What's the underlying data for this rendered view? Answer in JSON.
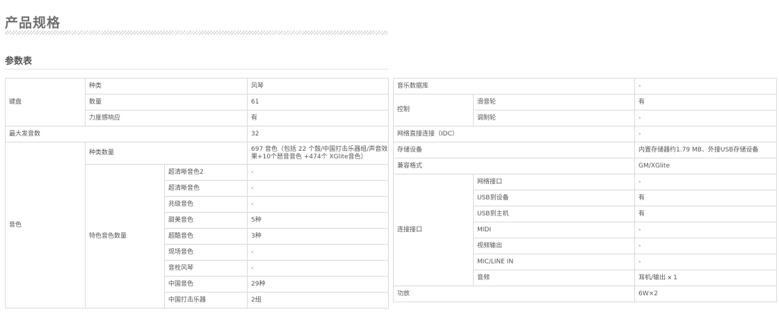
{
  "page_title": "产品规格",
  "section_title": "参数表",
  "left_table": {
    "keyboard": {
      "label": "键盘",
      "type_label": "种类",
      "type_value": "风琴",
      "count_label": "数量",
      "count_value": "61",
      "velocity_label": "力度感响应",
      "velocity_value": "有"
    },
    "polyphony": {
      "label": "最大发音数",
      "value": "32"
    },
    "voices": {
      "label": "音色",
      "count_label": "种类数量",
      "count_value": "697 音色（包括 22 个鼓/中国打击乐器组/声音效果+10个琶音音色 +474个 XGlite音色）",
      "special_label": "特色音色数量",
      "special": [
        {
          "label": "超清晰音色2",
          "value": "-"
        },
        {
          "label": "超清晰音色",
          "value": "-"
        },
        {
          "label": "兆级音色",
          "value": "-"
        },
        {
          "label": "甜美音色",
          "value": "5种"
        },
        {
          "label": "超酷音色",
          "value": "3种"
        },
        {
          "label": "现场音色",
          "value": "-"
        },
        {
          "label": "音栓风琴",
          "value": "-"
        },
        {
          "label": "中国音色",
          "value": "29种"
        },
        {
          "label": "中国打击乐器",
          "value": "2组"
        }
      ]
    }
  },
  "right_table": {
    "music_db": {
      "label": "音乐数据库",
      "value": "-"
    },
    "control": {
      "label": "控制",
      "pitch_label": "滑音轮",
      "pitch_value": "有",
      "mod_label": "调制轮",
      "mod_value": "-"
    },
    "idc": {
      "label": "网络直接连接（IDC）",
      "value": "-"
    },
    "storage": {
      "label": "存储设备",
      "value": "内置存储器约1.79 MB、外接USB存储设备"
    },
    "format": {
      "label": "兼容格式",
      "value": "GM/XGlite"
    },
    "ports": {
      "label": "连接接口",
      "items": [
        {
          "label": "网络接口",
          "value": "-"
        },
        {
          "label": "USB到设备",
          "value": "有"
        },
        {
          "label": "USB到主机",
          "value": "有"
        },
        {
          "label": "MIDI",
          "value": "-"
        },
        {
          "label": "视频输出",
          "value": "-"
        },
        {
          "label": "MIC/LINE IN",
          "value": "-"
        },
        {
          "label": "音频",
          "value": "耳机/输出 x 1"
        }
      ]
    },
    "amp": {
      "label": "功放",
      "value": "6W×2"
    }
  }
}
